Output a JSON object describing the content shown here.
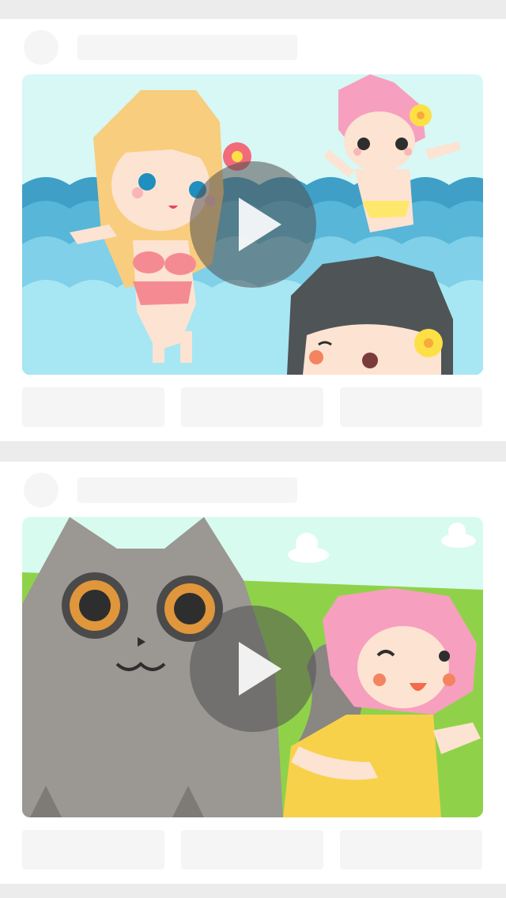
{
  "feed": {
    "posts": [
      {
        "kind": "video",
        "thumbnail": "beach-girls-cartoon",
        "play_icon": "play-icon",
        "skeleton": true
      },
      {
        "kind": "video",
        "thumbnail": "cat-and-girl-cartoon",
        "play_icon": "play-icon",
        "skeleton": true
      }
    ]
  },
  "colors": {
    "background": "#ececec",
    "card": "#ffffff",
    "skeleton": "#f5f5f5",
    "play_overlay": "#505050",
    "play_glyph": "#ffffff"
  }
}
